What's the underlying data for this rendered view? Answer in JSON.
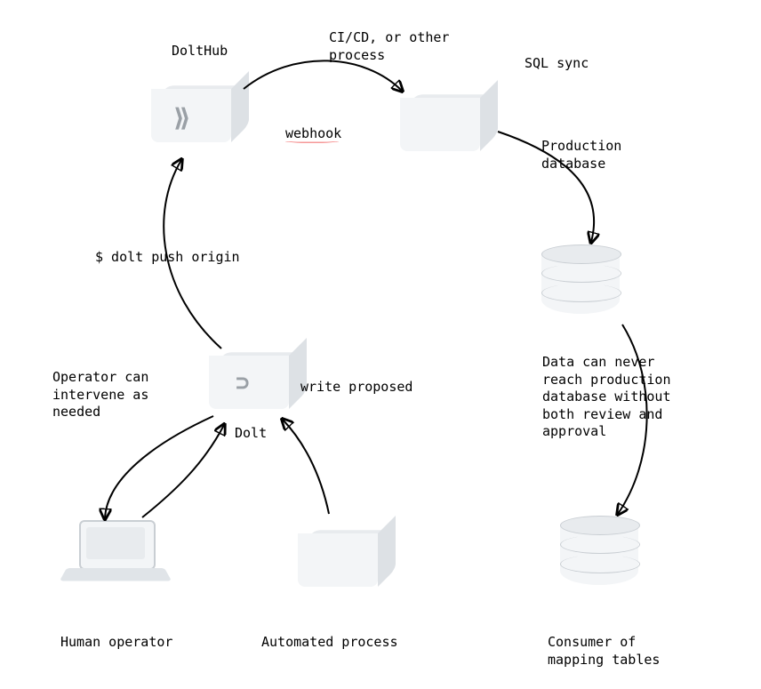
{
  "nodes": {
    "dolthub": {
      "label": "DoltHub"
    },
    "cicd": {
      "label": "CI/CD, or other\nprocess"
    },
    "sqlsync": {
      "label": "SQL sync"
    },
    "proddb": {
      "label": "Production\ndatabase"
    },
    "dolt": {
      "label": "Dolt"
    },
    "human": {
      "label": "Human operator"
    },
    "automated": {
      "label": "Automated process"
    },
    "consumer": {
      "label": "Consumer of\nmapping tables"
    }
  },
  "edges": {
    "webhook": {
      "label": "webhook"
    },
    "push": {
      "label": "$ dolt push origin"
    },
    "intervene": {
      "label": "Operator can\nintervene as\nneeded"
    },
    "write_proposed": {
      "label": "write proposed"
    },
    "note": {
      "label": "Data can never\nreach production\ndatabase without\nboth review and\napproval"
    }
  }
}
